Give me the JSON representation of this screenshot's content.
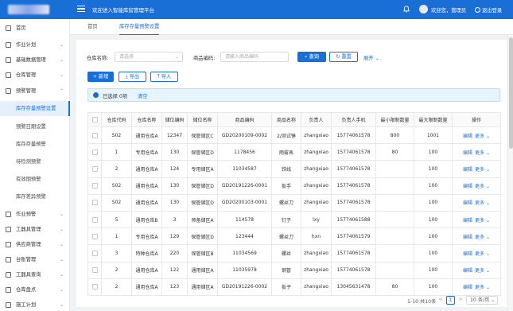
{
  "header": {
    "welcome_text": "欢迎进入智能库房管理平台",
    "user_greeting": "欢迎您，管理员",
    "logout_label": "退出登录"
  },
  "sidebar": {
    "items": [
      {
        "label": "首页",
        "icon": "home-icon",
        "expand": ""
      },
      {
        "label": "作业计划",
        "icon": "calendar-icon",
        "expand": "⌄"
      },
      {
        "label": "基础数据管理",
        "icon": "database-icon",
        "expand": "⌄"
      },
      {
        "label": "仓库管理",
        "icon": "warehouse-icon",
        "expand": "⌄"
      },
      {
        "label": "预警管理",
        "icon": "alert-icon",
        "expand": "⌃"
      }
    ],
    "subitems": [
      {
        "label": "库存存量预警设置",
        "active": true
      },
      {
        "label": "预警日期设置",
        "active": false
      },
      {
        "label": "库存存量预警",
        "active": false
      },
      {
        "label": "待检测预警",
        "active": false
      },
      {
        "label": "有效期预警",
        "active": false
      },
      {
        "label": "库存差异预警",
        "active": false
      }
    ],
    "items_bottom": [
      {
        "label": "作业预警",
        "icon": "clipboard-icon"
      },
      {
        "label": "工器具管理",
        "icon": "tool-icon"
      },
      {
        "label": "供应商管理",
        "icon": "supplier-icon"
      },
      {
        "label": "台账管理",
        "icon": "ledger-icon"
      },
      {
        "label": "工器具查询",
        "icon": "search-icon"
      },
      {
        "label": "仓库盘点",
        "icon": "inventory-icon"
      },
      {
        "label": "施工计划",
        "icon": "plan-icon"
      }
    ]
  },
  "tabs": [
    {
      "label": "首页",
      "active": false
    },
    {
      "label": "库存存量预警设置",
      "active": true
    }
  ],
  "filters": {
    "warehouse_label": "仓库名称:",
    "warehouse_placeholder": "请选择",
    "code_label": "商品编码:",
    "code_placeholder": "请输入商品编码",
    "search_label": "查询",
    "reset_label": "重置",
    "expand_label": "展开"
  },
  "actions": {
    "add_label": "新增",
    "export_label": "导出",
    "import_label": "导入"
  },
  "selection": {
    "info": "已选择 0项",
    "clear_label": "清空"
  },
  "table": {
    "columns": [
      "",
      "仓库代码",
      "仓库名称",
      "储位编码",
      "储位名称",
      "商品编码",
      "商品名称",
      "负责人",
      "负责人手机",
      "最小限制数量",
      "最大限制数量",
      "操作"
    ],
    "edit_label": "编辑",
    "more_label": "更多",
    "rows": [
      [
        "S02",
        "通用仓库A",
        "12347",
        "保管储区C",
        "GD20200109-0002",
        "2/测试锤",
        "zhangxiao",
        "15774061578",
        "800",
        "1001"
      ],
      [
        "1",
        "专用仓库A",
        "130",
        "保管储区D",
        "1178456",
        "雨雾表",
        "zhangxiao",
        "15774061578",
        "80",
        "100"
      ],
      [
        "2",
        "通用仓库A",
        "124",
        "专用储区A",
        "11034587",
        "铁线",
        "zhangxiao",
        "15774061578",
        "",
        "100"
      ],
      [
        "S02",
        "通用仓库A",
        "130",
        "保管储区D",
        "GD20191226-0001",
        "扳手",
        "zhangxiao",
        "15774061578",
        "",
        "100"
      ],
      [
        "S02",
        "通用仓库A",
        "130",
        "保管储区D",
        "GD20200103-0001",
        "螺丝刀",
        "zhangxiao",
        "15774061578",
        "",
        "100"
      ],
      [
        "5",
        "通用仓库B",
        "3",
        "预备储区A",
        "114578",
        "钉子",
        "lxy",
        "15774061588",
        "",
        "100"
      ],
      [
        "1",
        "专用仓库A",
        "129",
        "保管储区D",
        "123444",
        "螺丝刀",
        "hxn",
        "15774061579",
        "",
        "100"
      ],
      [
        "3",
        "特种仓库A",
        "220",
        "保管储区B",
        "11034569",
        "螺丝",
        "zhangxiao",
        "15774061578",
        "",
        "100"
      ],
      [
        "2",
        "通用仓库A",
        "122",
        "通用储区A",
        "11035978",
        "钢管",
        "zhangxiao",
        "15774061578",
        "",
        "100"
      ],
      [
        "2",
        "通用仓库A",
        "123",
        "通用储区A",
        "GD20191226-0002",
        "扳子",
        "zhangxiao",
        "13045631478",
        "80",
        "100"
      ]
    ]
  },
  "pagination": {
    "total_text": "1-10 共10条",
    "prev": "<",
    "current": "1",
    "next": ">",
    "page_size": "10 条/页"
  },
  "colors": {
    "primary": "#1a6fd6",
    "topbar": "#1a6fd6",
    "active_bg": "#e6f0fd"
  }
}
